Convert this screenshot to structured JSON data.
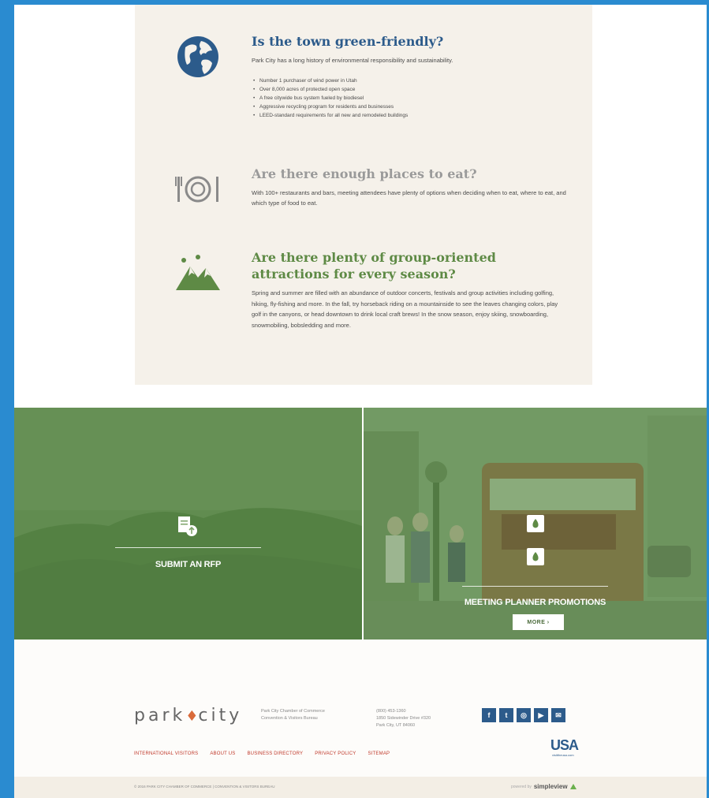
{
  "faq": [
    {
      "question": "Is the town green-friendly?",
      "question_color": "#2c5b8b",
      "answer": "Park City has a long history of environmental responsibility and sustainability.",
      "bullets": [
        "Number 1 purchaser of wind power in Utah",
        "Over 8,000 acres of protected open space",
        "A free citywide bus system fueled by biodiesel",
        "Aggressive recycling program for residents and businesses",
        "LEED-standard requirements for all new and remodeled buildings"
      ],
      "icon": "globe-icon"
    },
    {
      "question": "Are there enough places to eat?",
      "question_color": "#9a9a9a",
      "answer": "With 100+ restaurants and bars, meeting attendees have plenty of options when deciding when to eat, where to eat, and which type of food to eat.",
      "icon": "plate-icon"
    },
    {
      "question": "Are there plenty of group-oriented attractions for every season?",
      "question_color": "#5e8a45",
      "answer": "Spring and summer are filled with an abundance of outdoor concerts, festivals and group activities including golfing, hiking, fly-fishing and more. In the fall, try horseback riding on a mountainside to see the leaves changing colors, play golf in the canyons, or head downtown to drink local craft brews! In the snow season, enjoy skiing, snowboarding, snowmobiling, bobsledding and more.",
      "icon": "mountain-icon"
    }
  ],
  "promos": {
    "rfp_label": "SUBMIT AN RFP",
    "meeting_label": "MEETING PLANNER PROMOTIONS",
    "more_label": "MORE ›"
  },
  "footer": {
    "logo_left": "park",
    "logo_right": "city",
    "org_lines": [
      "Park City Chamber of Commerce",
      "Convention & Visitors Bureau"
    ],
    "address_lines": [
      "(800) 453-1360",
      "1850 Sidewinder Drive #320",
      "Park City, UT 84060"
    ],
    "social": [
      "f",
      "t",
      "◎",
      "▶",
      "✉"
    ],
    "usa": "USA",
    "usa_sub": "visittheusa.com",
    "links": [
      "INTERNATIONAL VISITORS",
      "ABOUT US",
      "BUSINESS DIRECTORY",
      "PRIVACY POLICY",
      "SITEMAP"
    ],
    "copyright": "© 2016 PARK CITY CHAMBER OF COMMERCE | CONVENTION & VISITORS BUREAU",
    "powered_by": "powered by",
    "powered_brand": "simpleview"
  },
  "colors": {
    "accent_blue": "#2c5b8b",
    "accent_green": "#5e8a45",
    "link_red": "#c0392b"
  }
}
